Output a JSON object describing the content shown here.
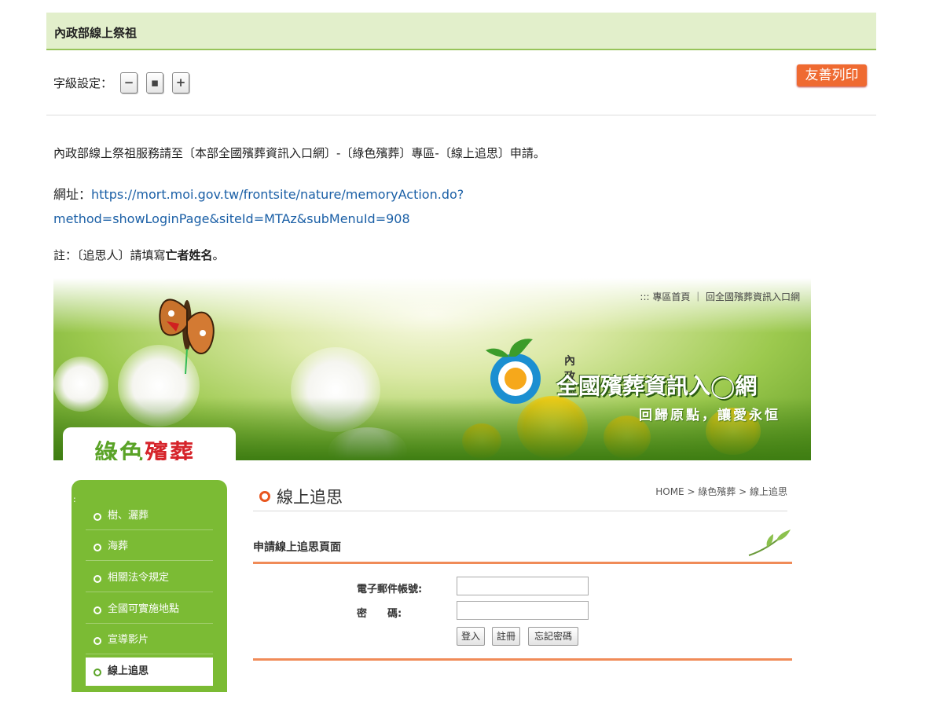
{
  "header": {
    "title": "內政部線上祭祖"
  },
  "font_size": {
    "label": "字級設定：",
    "decrease": "−",
    "normal": "▪",
    "increase": "+"
  },
  "print_button": "友善列印",
  "body": {
    "intro": "內政部線上祭祖服務請至〔本部全國殯葬資訊入口網〕-〔綠色殯葬〕專區-〔線上追思〕申請。",
    "url_label": "網址：",
    "url_line1": "https://mort.moi.gov.tw/frontsite/nature/memoryAction.do?",
    "url_line2": "method=showLoginPage&siteId=MTAz&subMenuId=908",
    "note_prefix": "註：〔追思人〕請填寫",
    "note_bold": "亡者姓名",
    "note_suffix": "。"
  },
  "screenshot": {
    "top_nav": "::: 專區首頁 ｜ 回全國殯葬資訊入口網",
    "logo_sub": "內政部",
    "logo_main": "全國殯葬資訊入◯網",
    "slogan": "回歸原點，讓愛永恒",
    "section_tab_green": "綠色",
    "section_tab_red": "殯葬",
    "sidebar_dots": ":",
    "sidebar": [
      {
        "label": "樹、灑葬"
      },
      {
        "label": "海葬"
      },
      {
        "label": "相關法令規定"
      },
      {
        "label": "全國可實施地點"
      },
      {
        "label": "宣導影片"
      },
      {
        "label": "線上追思"
      }
    ],
    "page_title": "線上追思",
    "breadcrumb": "HOME > 綠色殯葬 > 線上追思",
    "form_title": "申請線上追思頁面",
    "email_label": "電子郵件帳號:",
    "password_label": "密　　碼:",
    "login_button": "登入",
    "register_button": "註冊",
    "forgot_button": "忘記密碼"
  },
  "colors": {
    "header_bg": "#e2efcb",
    "accent_green": "#7bbb34",
    "print_orange": "#ef6a31",
    "link_blue": "#1a5fa6"
  }
}
